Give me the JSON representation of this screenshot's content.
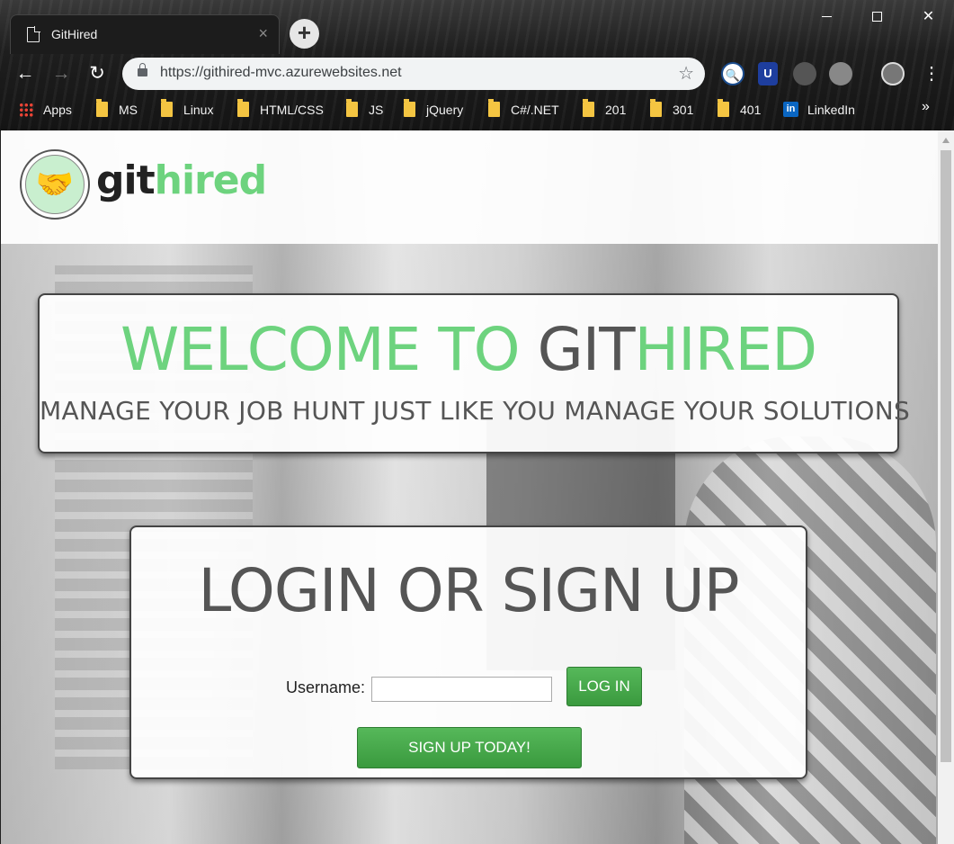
{
  "browser": {
    "tab": {
      "title": "GitHired",
      "close": "×"
    },
    "new_tab": "+",
    "window": {
      "minimize": "",
      "maximize": "",
      "close": "✕"
    },
    "nav": {
      "back": "←",
      "forward": "→",
      "reload": "↻"
    },
    "address": {
      "url": "https://githired-mvc.azurewebsites.net",
      "star": "☆"
    },
    "extensions": [
      {
        "icon": "magnifier-extension-icon",
        "label": "🔍"
      },
      {
        "icon": "shield-extension-icon",
        "label": "U"
      },
      {
        "icon": "gray-extension-icon",
        "label": ""
      },
      {
        "icon": "robot-extension-icon",
        "label": ""
      },
      {
        "icon": "profile-avatar-icon",
        "label": ""
      }
    ],
    "menu": "⋮",
    "bookmarks": [
      {
        "label": "Apps",
        "icon": "apps-grid-icon"
      },
      {
        "label": "MS",
        "icon": "folder-icon"
      },
      {
        "label": "Linux",
        "icon": "folder-icon"
      },
      {
        "label": "HTML/CSS",
        "icon": "folder-icon"
      },
      {
        "label": "JS",
        "icon": "folder-icon"
      },
      {
        "label": "jQuery",
        "icon": "folder-icon"
      },
      {
        "label": "C#/.NET",
        "icon": "folder-icon"
      },
      {
        "label": "201",
        "icon": "folder-icon"
      },
      {
        "label": "301",
        "icon": "folder-icon"
      },
      {
        "label": "401",
        "icon": "folder-icon"
      },
      {
        "label": "LinkedIn",
        "icon": "linkedin-icon"
      }
    ],
    "bookmarks_more": "»"
  },
  "site": {
    "logo": {
      "git": "git",
      "hired": "hired",
      "icon": "handshake-icon",
      "glyph": "🤝"
    },
    "welcome": {
      "title_part1": "WELCOME TO ",
      "title_part2": "GIT",
      "title_part3": "HIRED",
      "subtitle": "MANAGE YOUR JOB HUNT JUST LIKE YOU MANAGE YOUR SOLUTIONS"
    },
    "login": {
      "heading": "LOGIN OR SIGN UP",
      "username_label": "Username:",
      "username_value": "",
      "login_button": "LOG IN",
      "signup_button": "SIGN UP TODAY!"
    }
  },
  "colors": {
    "brand_green": "#6dd37e",
    "brand_dark": "#555555",
    "button_green": "#3a9a3e"
  }
}
